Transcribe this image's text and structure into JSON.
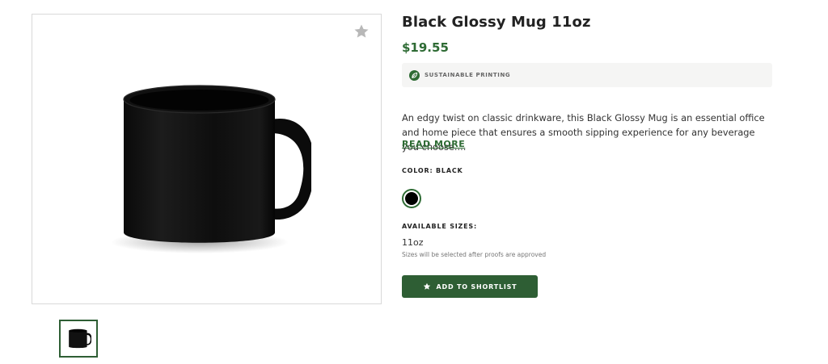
{
  "gallery": {
    "favorite_icon": "star-icon",
    "main_image": "black-glossy-mug",
    "thumbnail_image": "black-glossy-mug-thumbnail"
  },
  "product": {
    "title": "Black Glossy Mug 11oz",
    "price": "$19.55",
    "badge": {
      "icon": "leaf-icon",
      "label": "SUSTAINABLE PRINTING"
    },
    "description": "An edgy twist on classic drinkware, this Black Glossy Mug is an essential office and home piece that ensures a smooth sipping experience for any beverage you choose....",
    "read_more_label": "READ MORE",
    "color_label": "COLOR: BLACK",
    "colors": [
      {
        "name": "Black",
        "hex": "#000000",
        "selected": true
      }
    ],
    "sizes_label": "AVAILABLE SIZES:",
    "size_value": "11oz",
    "size_note": "Sizes will be selected after proofs are approved",
    "cta": {
      "icon": "star-icon",
      "label": "ADD TO SHORTLIST"
    }
  },
  "theme": {
    "accent": "#2e6b34",
    "button_bg": "#2e5e34",
    "badge_bg": "#f5f5f4"
  }
}
